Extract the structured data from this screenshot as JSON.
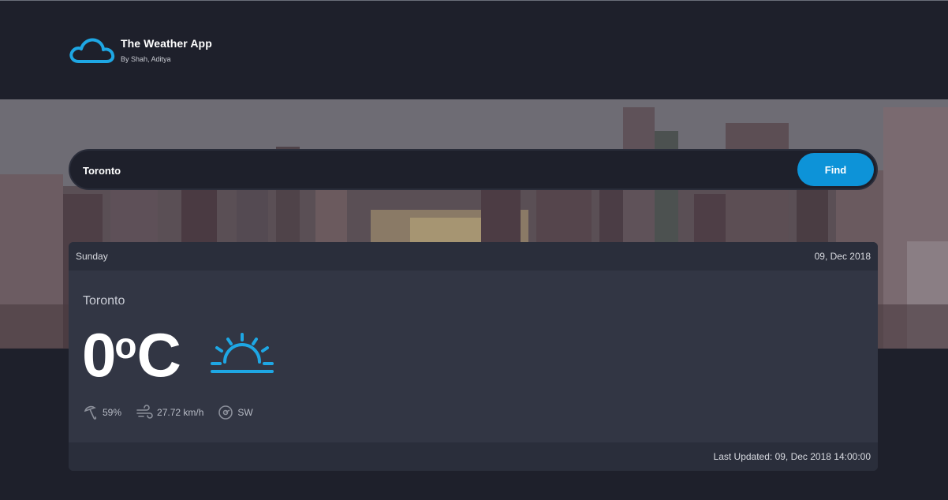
{
  "app": {
    "title": "The Weather App",
    "subtitle": "By Shah, Aditya",
    "logo_icon": "cloud-icon",
    "accent_color": "#1ea7e4"
  },
  "search": {
    "value": "Toronto",
    "button_label": "Find",
    "button_color": "#0d93d8"
  },
  "weather": {
    "day": "Sunday",
    "date": "09, Dec 2018",
    "city": "Toronto",
    "temperature": "0",
    "unit": "C",
    "degree_symbol": "o",
    "condition_icon": "sunrise-icon",
    "humidity": "59%",
    "wind_speed": "27.72 km/h",
    "wind_direction": "SW",
    "last_updated": "Last Updated: 09, Dec 2018 14:00:00"
  }
}
